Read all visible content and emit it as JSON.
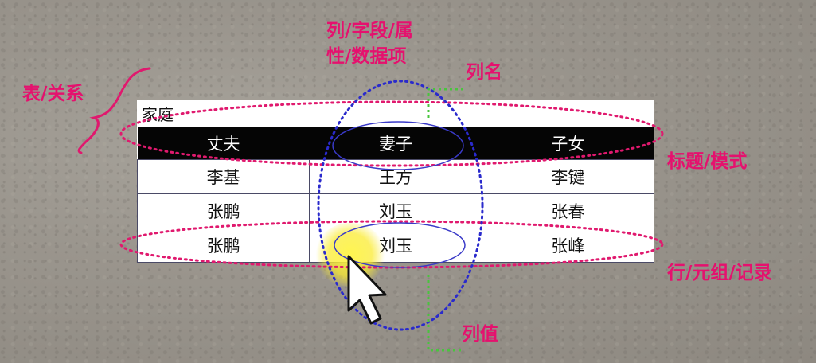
{
  "labels": {
    "table_relation": "表/关系",
    "column_field_attr_line1": "列/字段/属",
    "column_field_attr_line2": "性/数据项",
    "column_name": "列名",
    "header_schema": "标题/模式",
    "row_tuple_record": "行/元组/记录",
    "column_value": "列值"
  },
  "table": {
    "title": "家庭",
    "headers": [
      "丈夫",
      "妻子",
      "子女"
    ],
    "rows": [
      [
        "李基",
        "王方",
        "李键"
      ],
      [
        "张鹏",
        "刘玉",
        "张春"
      ],
      [
        "张鹏",
        "刘玉",
        "张峰"
      ]
    ]
  },
  "colors": {
    "label": "#e5116e",
    "ellipse_magenta": "#e0196e",
    "ellipse_blue": "#2a2acc",
    "dotted_green": "#49c43e",
    "header_bg": "#050505"
  }
}
